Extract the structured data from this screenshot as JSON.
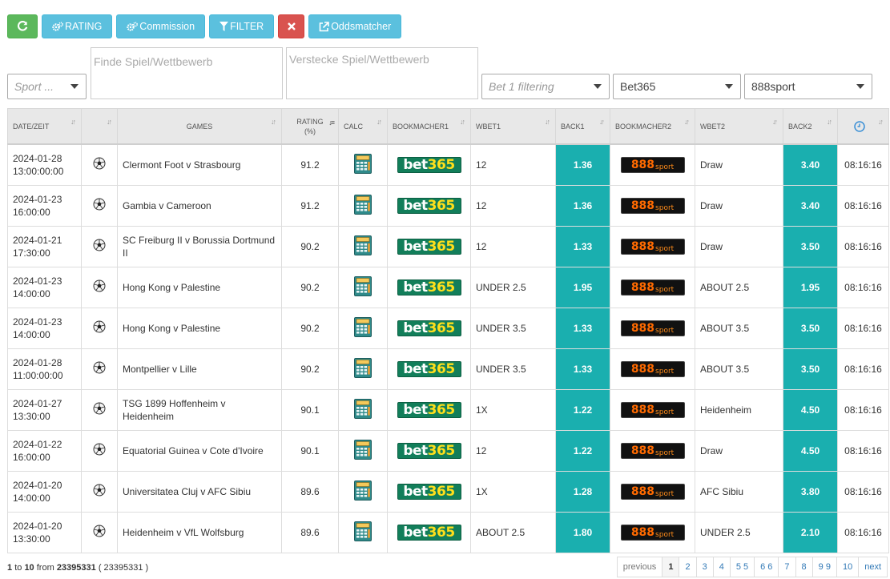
{
  "toolbar": {
    "rating_label": "RATING",
    "commission_label": "Commission",
    "filter_label": "FILTER",
    "oddsmatcher_label": "Oddsmatcher"
  },
  "filters": {
    "sport_placeholder": "Sport ...",
    "find_placeholder": "Finde Spiel/Wettbewerb",
    "hide_placeholder": "Verstecke Spiel/Wettbewerb",
    "bet1_placeholder": "Bet 1 filtering",
    "bookmaker1_value": "Bet365",
    "bookmaker2_value": "888sport"
  },
  "columns": {
    "date": "DATE/ZEIT",
    "games": "GAMES",
    "rating": "RATING",
    "rating_unit": "(%)",
    "calc": "CALC",
    "bookmacher1": "BOOKMACHER1",
    "wbet1": "WBET1",
    "back1": "BACK1",
    "bookmacher2": "BOOKMACHER2",
    "wbet2": "WBET2",
    "back2": "BACK2"
  },
  "logos": {
    "bm1_a": "bet",
    "bm1_b": "365",
    "bm2_a": "888",
    "bm2_b": "sport"
  },
  "rows": [
    {
      "date": "2024-01-28",
      "time": "13:00:00:00",
      "game": "Clermont Foot v Strasbourg",
      "rating": "91.2",
      "wbet1": "12",
      "back1": "1.36",
      "wbet2": "Draw",
      "back2": "3.40",
      "updated": "08:16:16"
    },
    {
      "date": "2024-01-23",
      "time": "16:00:00",
      "game": "Gambia v Cameroon",
      "rating": "91.2",
      "wbet1": "12",
      "back1": "1.36",
      "wbet2": "Draw",
      "back2": "3.40",
      "updated": "08:16:16"
    },
    {
      "date": "2024-01-21",
      "time": "17:30:00",
      "game": "SC Freiburg II v Borussia Dortmund II",
      "rating": "90.2",
      "wbet1": "12",
      "back1": "1.33",
      "wbet2": "Draw",
      "back2": "3.50",
      "updated": "08:16:16"
    },
    {
      "date": "2024-01-23",
      "time": "14:00:00",
      "game": "Hong Kong v Palestine",
      "rating": "90.2",
      "wbet1": "UNDER 2.5",
      "back1": "1.95",
      "wbet2": "ABOUT 2.5",
      "back2": "1.95",
      "updated": "08:16:16"
    },
    {
      "date": "2024-01-23",
      "time": "14:00:00",
      "game": "Hong Kong v Palestine",
      "rating": "90.2",
      "wbet1": "UNDER 3.5",
      "back1": "1.33",
      "wbet2": "ABOUT 3.5",
      "back2": "3.50",
      "updated": "08:16:16"
    },
    {
      "date": "2024-01-28",
      "time": "11:00:00:00",
      "game": "Montpellier v Lille",
      "rating": "90.2",
      "wbet1": "UNDER 3.5",
      "back1": "1.33",
      "wbet2": "ABOUT 3.5",
      "back2": "3.50",
      "updated": "08:16:16"
    },
    {
      "date": "2024-01-27",
      "time": "13:30:00",
      "game": "TSG 1899 Hoffenheim v Heidenheim",
      "rating": "90.1",
      "wbet1": "1X",
      "back1": "1.22",
      "wbet2": "Heidenheim",
      "back2": "4.50",
      "updated": "08:16:16"
    },
    {
      "date": "2024-01-22",
      "time": "16:00:00",
      "game": "Equatorial Guinea v Cote d'Ivoire",
      "rating": "90.1",
      "wbet1": "12",
      "back1": "1.22",
      "wbet2": "Draw",
      "back2": "4.50",
      "updated": "08:16:16"
    },
    {
      "date": "2024-01-20",
      "time": "14:00:00",
      "game": "Universitatea Cluj v AFC Sibiu",
      "rating": "89.6",
      "wbet1": "1X",
      "back1": "1.28",
      "wbet2": "AFC Sibiu",
      "back2": "3.80",
      "updated": "08:16:16"
    },
    {
      "date": "2024-01-20",
      "time": "13:30:00",
      "game": "Heidenheim v VfL Wolfsburg",
      "rating": "89.6",
      "wbet1": "ABOUT 2.5",
      "back1": "1.80",
      "wbet2": "UNDER 2.5",
      "back2": "2.10",
      "updated": "08:16:16"
    }
  ],
  "footer": {
    "from_index": "1",
    "to_word": "to",
    "to_index": "10",
    "from_word": "from",
    "total": "23395331",
    "total_paren": "( 23395331 )"
  },
  "pagination": {
    "previous": "previous",
    "pages": [
      "1",
      "2",
      "3",
      "4",
      "5 5",
      "6 6",
      "7",
      "8",
      "9 9",
      "10"
    ],
    "next": "next"
  },
  "colors": {
    "back_cell": "#1aafaf",
    "refresh_btn": "#5cb85c",
    "info_btn": "#5bc0de",
    "clear_btn": "#d9534f"
  },
  "icons": [
    "refresh-icon",
    "gears-icon",
    "funnel-icon",
    "times-icon",
    "external-link-icon",
    "clock-icon",
    "soccer-ball-icon",
    "calculator-icon",
    "sort-icon"
  ]
}
